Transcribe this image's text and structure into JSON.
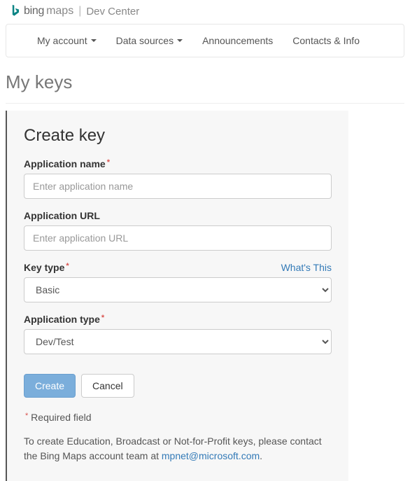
{
  "header": {
    "brand_bing": "bing",
    "brand_maps": "maps",
    "divider": "|",
    "devcenter": "Dev Center"
  },
  "nav": {
    "my_account": "My account",
    "data_sources": "Data sources",
    "announcements": "Announcements",
    "contacts": "Contacts & Info"
  },
  "page": {
    "title": "My keys"
  },
  "form": {
    "title": "Create key",
    "app_name": {
      "label": "Application name",
      "placeholder": "Enter application name"
    },
    "app_url": {
      "label": "Application URL",
      "placeholder": "Enter application URL"
    },
    "key_type": {
      "label": "Key type",
      "whats_this": "What's This",
      "value": "Basic"
    },
    "app_type": {
      "label": "Application type",
      "value": "Dev/Test"
    },
    "create_btn": "Create",
    "cancel_btn": "Cancel",
    "required_text": "Required field",
    "footer_text_1": "To create Education, Broadcast or Not-for-Profit keys, please contact the Bing Maps account team at ",
    "footer_email": "mpnet@microsoft.com",
    "footer_text_2": "."
  }
}
